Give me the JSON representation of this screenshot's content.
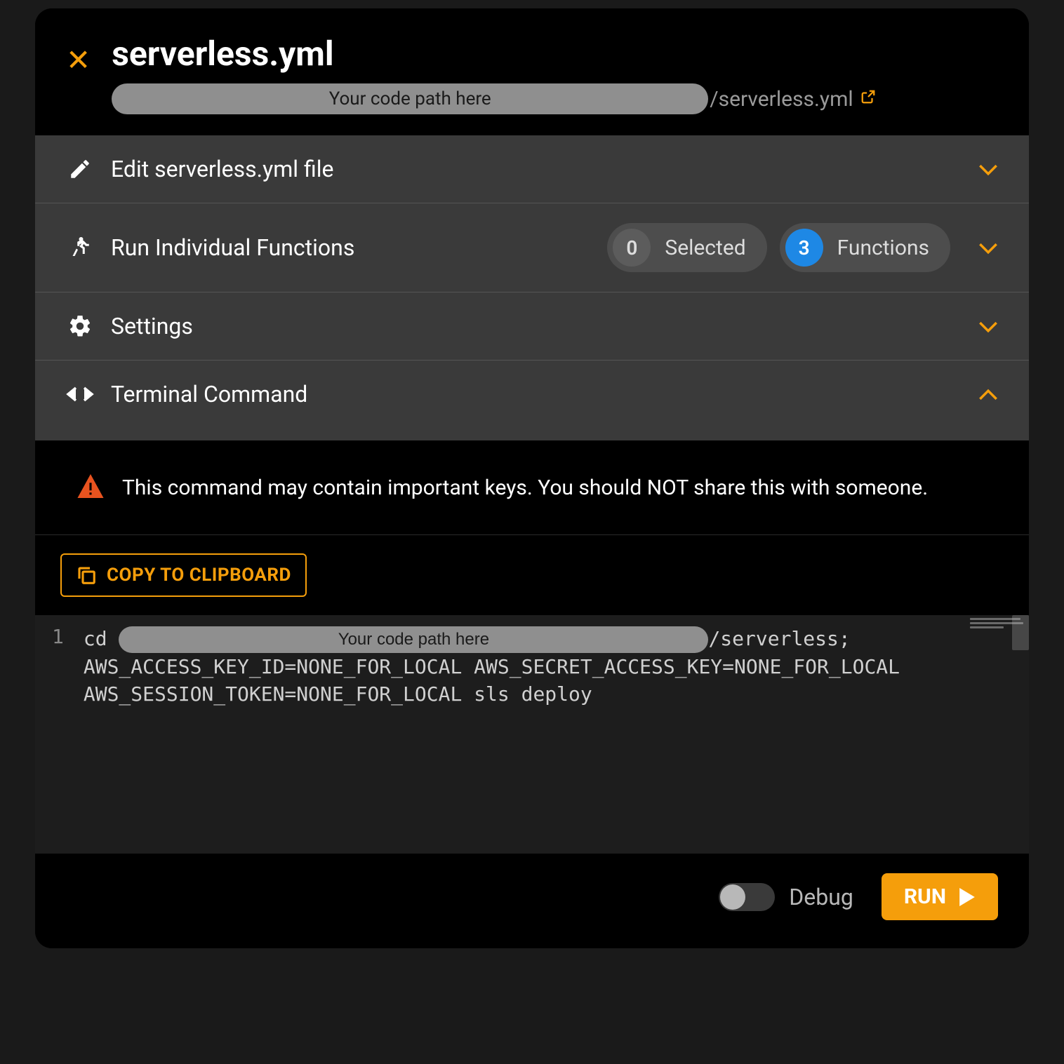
{
  "header": {
    "title": "serverless.yml",
    "path_mask": "Your code path here",
    "path_tail": "/serverless.yml"
  },
  "sections": {
    "edit": {
      "title": "Edit serverless.yml file"
    },
    "run_funcs": {
      "title": "Run Individual Functions",
      "selected_count": "0",
      "selected_label": "Selected",
      "functions_count": "3",
      "functions_label": "Functions"
    },
    "settings": {
      "title": "Settings"
    },
    "terminal": {
      "title": "Terminal Command"
    }
  },
  "warning": {
    "text": "This command may contain important keys. You should NOT share this with someone."
  },
  "copy": {
    "label": "COPY TO CLIPBOARD"
  },
  "code": {
    "line_number": "1",
    "prefix": "cd ",
    "mask": "Your code path here",
    "suffix1": "/serverless;",
    "line2": "AWS_ACCESS_KEY_ID=NONE_FOR_LOCAL AWS_SECRET_ACCESS_KEY=NONE_FOR_LOCAL",
    "line3": "AWS_SESSION_TOKEN=NONE_FOR_LOCAL sls deploy"
  },
  "footer": {
    "debug_label": "Debug",
    "run_label": "RUN"
  }
}
